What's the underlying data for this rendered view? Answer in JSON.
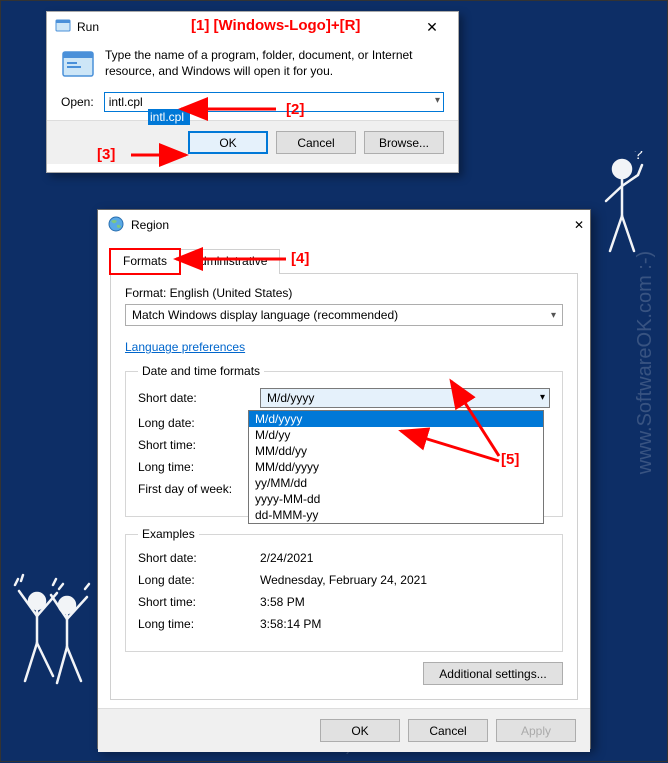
{
  "watermarks": {
    "text": "www.SoftwareOK.com :-)"
  },
  "run": {
    "title": "Run",
    "desc": "Type the name of a program, folder, document, or Internet resource, and Windows will open it for you.",
    "open_label": "Open:",
    "open_value": "intl.cpl",
    "ok": "OK",
    "cancel": "Cancel",
    "browse": "Browse..."
  },
  "region": {
    "title": "Region",
    "tabs": {
      "formats": "Formats",
      "admin": "Administrative"
    },
    "format_label": "Format: English (United States)",
    "format_value": "Match Windows display language (recommended)",
    "lang_prefs": "Language preferences",
    "group1": "Date and time formats",
    "short_date_label": "Short date:",
    "short_date_value": "M/d/yyyy",
    "short_date_options": [
      "M/d/yyyy",
      "M/d/yy",
      "MM/dd/yy",
      "MM/dd/yyyy",
      "yy/MM/dd",
      "yyyy-MM-dd",
      "dd-MMM-yy"
    ],
    "long_date_label": "Long date:",
    "short_time_label": "Short time:",
    "long_time_label": "Long time:",
    "first_day_label": "First day of week:",
    "group2": "Examples",
    "ex_short_date": "2/24/2021",
    "ex_long_date": "Wednesday, February 24, 2021",
    "ex_short_time": "3:58 PM",
    "ex_long_time": "3:58:14 PM",
    "additional": "Additional settings...",
    "ok": "OK",
    "cancel": "Cancel",
    "apply": "Apply"
  },
  "annotations": {
    "a1": "[1]  [Windows-Logo]+[R]",
    "a2": "[2]",
    "a3": "[3]",
    "a4": "[4]",
    "a5": "[5]"
  }
}
